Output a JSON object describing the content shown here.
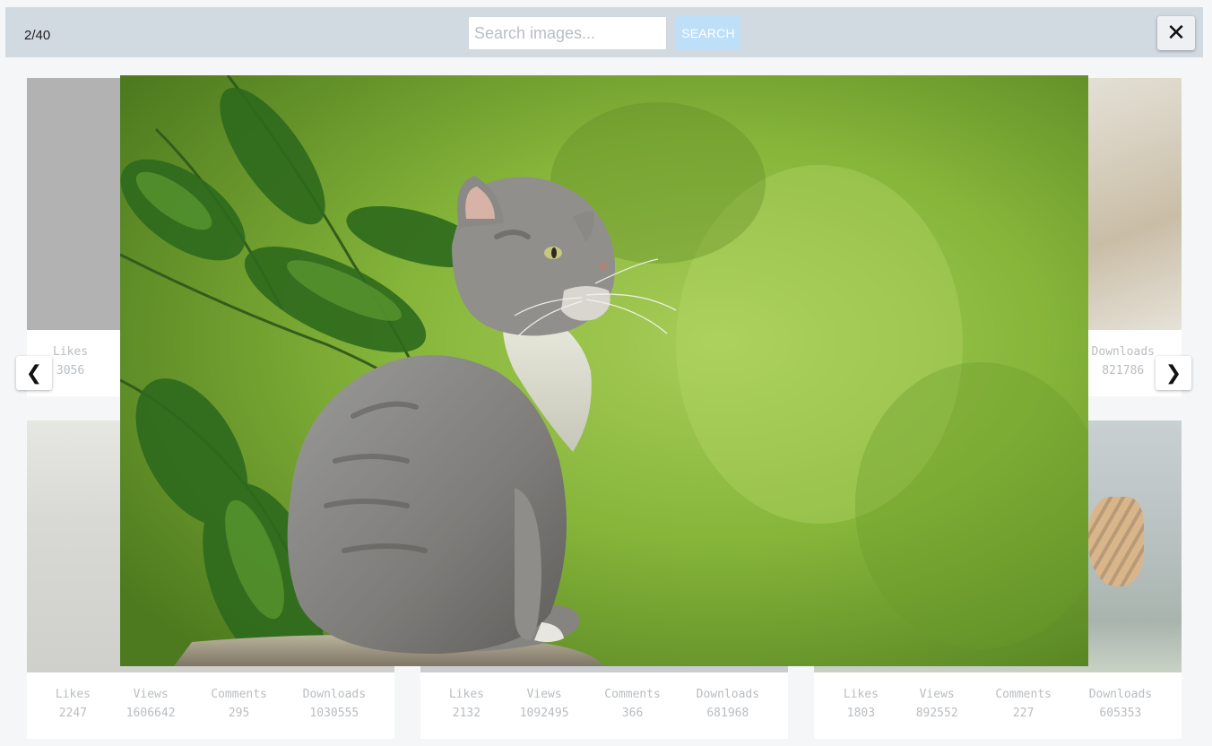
{
  "header": {
    "counter": "2/40",
    "search_placeholder": "Search images...",
    "search_value": "",
    "search_button_label": "SEARCH",
    "close_label": "✕"
  },
  "navigation": {
    "prev_label": "❮",
    "next_label": "❯"
  },
  "stat_labels": {
    "likes": "Likes",
    "views": "Views",
    "comments": "Comments",
    "downloads": "Downloads"
  },
  "gallery": {
    "top_left": {
      "likes": "3056"
    },
    "top_right": {
      "downloads": "821786"
    },
    "bottom": [
      {
        "likes": "2247",
        "views": "1606642",
        "comments": "295",
        "downloads": "1030555"
      },
      {
        "likes": "2132",
        "views": "1092495",
        "comments": "366",
        "downloads": "681968"
      },
      {
        "likes": "1803",
        "views": "892552",
        "comments": "227",
        "downloads": "605353"
      }
    ]
  },
  "modal": {
    "image_subject": "kitten-photo"
  },
  "colors": {
    "topbar_bg": "#d1d9e1",
    "search_button_bg": "#bde0f8",
    "stat_text": "#b9bdc1"
  }
}
